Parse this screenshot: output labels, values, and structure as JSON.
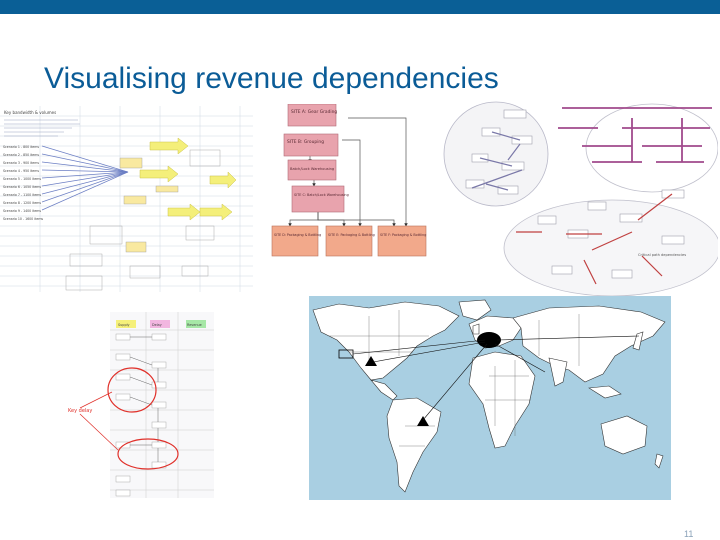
{
  "slide": {
    "title": "Visualising revenue dependencies",
    "page_number": "11",
    "accent_color": "#0a5f96"
  },
  "panels": {
    "spreadsheet": {
      "heading": "Key bandwidth & volumes",
      "rows": [
        "Scenario 1 - 800 items",
        "Scenario 2 - 850 items",
        "Scenario 3 - 900 items",
        "Scenario 4 - 950 items",
        "Scenario 5 - 1000 items",
        "Scenario 6 - 1050 items",
        "Scenario 7 - 1100 items",
        "Scenario 8 - 1200 items",
        "Scenario 9 - 1400 items",
        "Scenario 10 - 1600 items"
      ]
    },
    "flowchart": {
      "site_boxes": [
        "SITE A: Gear Grading",
        "SITE B: Grouping",
        "Batch/Lock Warehousing",
        "SITE C: Batch/Lock Warehousing"
      ],
      "packaging_boxes": [
        "SITE D: Packaging & Bottling",
        "SITE E: Packaging & Bottling",
        "SITE F: Packaging & Bottling"
      ]
    },
    "network": {
      "caption": "Critical path dependencies"
    },
    "timeline": {
      "annotation": "Key delay",
      "headers": [
        "Supply",
        "Delay",
        "Revenue"
      ]
    },
    "map": {
      "ocean_color": "#a9cfe2",
      "land_color": "#ffffff",
      "highlight_color": "#000000"
    }
  }
}
